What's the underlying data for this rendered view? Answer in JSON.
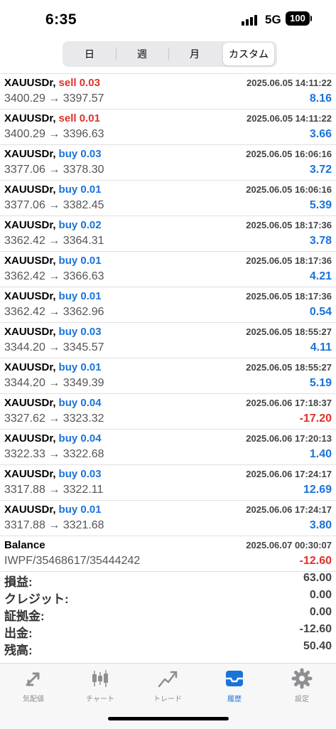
{
  "status": {
    "time": "6:35",
    "network": "5G",
    "battery": "100"
  },
  "periods": {
    "day": "日",
    "week": "週",
    "month": "月",
    "custom": "カスタム"
  },
  "trades": [
    {
      "symbol": "XAUUSDr",
      "type": "sell",
      "lots": "0.03",
      "time": "2025.06.05 14:11:22",
      "open": "3400.29",
      "close": "3397.57",
      "profit": "8.16"
    },
    {
      "symbol": "XAUUSDr",
      "type": "sell",
      "lots": "0.01",
      "time": "2025.06.05 14:11:22",
      "open": "3400.29",
      "close": "3396.63",
      "profit": "3.66"
    },
    {
      "symbol": "XAUUSDr",
      "type": "buy",
      "lots": "0.03",
      "time": "2025.06.05 16:06:16",
      "open": "3377.06",
      "close": "3378.30",
      "profit": "3.72"
    },
    {
      "symbol": "XAUUSDr",
      "type": "buy",
      "lots": "0.01",
      "time": "2025.06.05 16:06:16",
      "open": "3377.06",
      "close": "3382.45",
      "profit": "5.39"
    },
    {
      "symbol": "XAUUSDr",
      "type": "buy",
      "lots": "0.02",
      "time": "2025.06.05 18:17:36",
      "open": "3362.42",
      "close": "3364.31",
      "profit": "3.78"
    },
    {
      "symbol": "XAUUSDr",
      "type": "buy",
      "lots": "0.01",
      "time": "2025.06.05 18:17:36",
      "open": "3362.42",
      "close": "3366.63",
      "profit": "4.21"
    },
    {
      "symbol": "XAUUSDr",
      "type": "buy",
      "lots": "0.01",
      "time": "2025.06.05 18:17:36",
      "open": "3362.42",
      "close": "3362.96",
      "profit": "0.54"
    },
    {
      "symbol": "XAUUSDr",
      "type": "buy",
      "lots": "0.03",
      "time": "2025.06.05 18:55:27",
      "open": "3344.20",
      "close": "3345.57",
      "profit": "4.11"
    },
    {
      "symbol": "XAUUSDr",
      "type": "buy",
      "lots": "0.01",
      "time": "2025.06.05 18:55:27",
      "open": "3344.20",
      "close": "3349.39",
      "profit": "5.19"
    },
    {
      "symbol": "XAUUSDr",
      "type": "buy",
      "lots": "0.04",
      "time": "2025.06.06 17:18:37",
      "open": "3327.62",
      "close": "3323.32",
      "profit": "-17.20"
    },
    {
      "symbol": "XAUUSDr",
      "type": "buy",
      "lots": "0.04",
      "time": "2025.06.06 17:20:13",
      "open": "3322.33",
      "close": "3322.68",
      "profit": "1.40"
    },
    {
      "symbol": "XAUUSDr",
      "type": "buy",
      "lots": "0.03",
      "time": "2025.06.06 17:24:17",
      "open": "3317.88",
      "close": "3322.11",
      "profit": "12.69"
    },
    {
      "symbol": "XAUUSDr",
      "type": "buy",
      "lots": "0.01",
      "time": "2025.06.06 17:24:17",
      "open": "3317.88",
      "close": "3321.68",
      "profit": "3.80"
    }
  ],
  "balance_entry": {
    "title": "Balance",
    "time": "2025.06.07 00:30:07",
    "comment": "IWPF/35468617/35444242",
    "amount": "-12.60"
  },
  "summary": [
    {
      "label": "損益:",
      "value": "63.00"
    },
    {
      "label": "クレジット:",
      "value": "0.00"
    },
    {
      "label": "証拠金:",
      "value": "0.00"
    },
    {
      "label": "出金:",
      "value": "-12.60"
    },
    {
      "label": "残高:",
      "value": "50.40"
    }
  ],
  "tabs": [
    {
      "label": "気配値",
      "icon": "quotes-icon"
    },
    {
      "label": "チャート",
      "icon": "chart-icon"
    },
    {
      "label": "トレード",
      "icon": "trade-icon"
    },
    {
      "label": "履歴",
      "icon": "history-icon"
    },
    {
      "label": "設定",
      "icon": "settings-icon"
    }
  ],
  "colors": {
    "buy": "#1a73d9",
    "sell": "#e0312a",
    "active_tab": "#1a73d9",
    "inactive_tab": "#8e8e93"
  }
}
